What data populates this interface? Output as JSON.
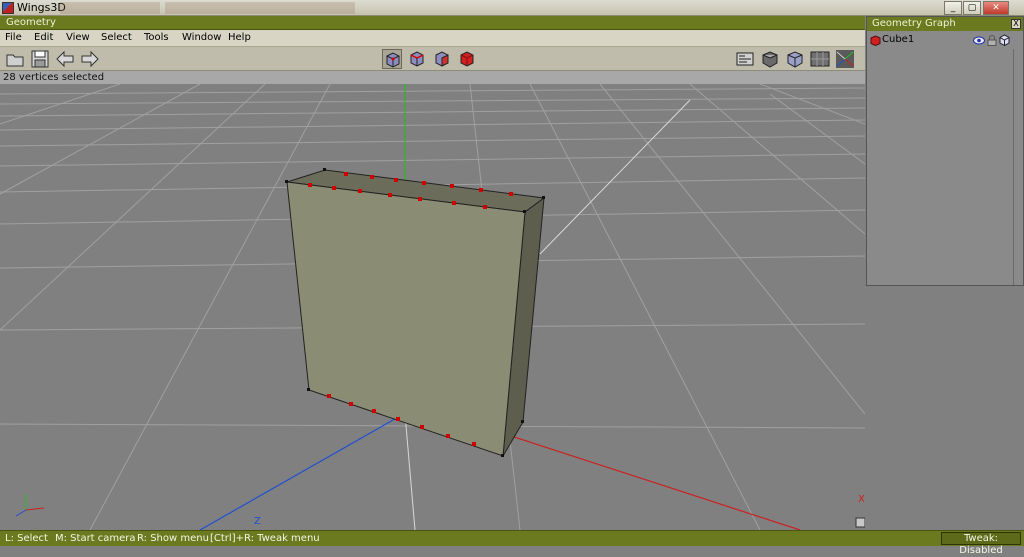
{
  "os_window": {
    "title": "Wings3D",
    "minimize_icon": "minimize-icon",
    "maximize_icon": "maximize-icon",
    "close_icon": "close-icon"
  },
  "geometry_window": {
    "title": "Geometry"
  },
  "menu": {
    "items": [
      "File",
      "Edit",
      "View",
      "Select",
      "Tools",
      "Window",
      "Help"
    ]
  },
  "toolbar": {
    "left_icons": [
      "open-folder-icon",
      "save-icon",
      "undo-arrow-icon",
      "redo-arrow-icon"
    ],
    "select_mode_icons": [
      "vertex-mode-icon",
      "edge-mode-icon",
      "face-mode-icon",
      "body-mode-icon"
    ],
    "selected_mode": "vertex-mode-icon",
    "right_icons": [
      "workmode-icon",
      "smooth-shade-icon",
      "flat-shade-icon",
      "ground-plane-icon",
      "axes-icon"
    ]
  },
  "selection_status": "28 vertices selected",
  "viewport": {
    "axis_labels": {
      "x": "X",
      "z": "Z"
    },
    "colors": {
      "x_axis": "#cc2020",
      "y_axis": "#20c020",
      "z_axis": "#2050d0",
      "grid": "#b0b0b0",
      "face": "#8a8c74",
      "selected_vertex": "#d00000"
    }
  },
  "geometry_graph": {
    "title": "Geometry Graph",
    "close_label": "X",
    "objects": [
      {
        "name": "Cube1",
        "icon": "cube-object-icon",
        "visibility_icon": "eye-icon",
        "lock_icon": "lock-icon",
        "wire_icon": "wireframe-cube-icon"
      }
    ]
  },
  "statusbar": {
    "hints": [
      "L: Select",
      "M: Start camera",
      "R: Show menu",
      "[Ctrl]+R: Tweak menu"
    ],
    "tweak": "Tweak: Disabled"
  }
}
